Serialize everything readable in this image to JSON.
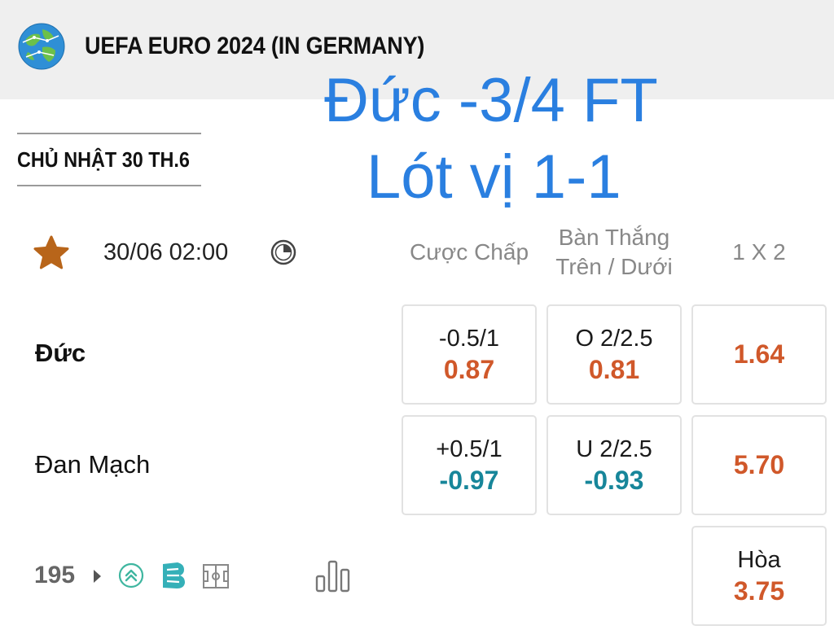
{
  "header": {
    "league_title": "UEFA EURO 2024 (IN GERMANY)",
    "league_icon": "globe-icon",
    "background": "#efefef"
  },
  "overlay": {
    "line1": "Đức -3/4 FT",
    "line2": "Lót vị 1-1",
    "color": "#2a7fe0"
  },
  "date_header": "CHỦ NHẬT 30 TH.6",
  "match": {
    "favorite_icon": "star-icon",
    "time": "30/06 02:00",
    "live_icon": "live-clock-icon",
    "home_team": "Đức",
    "away_team": "Đan Mạch",
    "more_markets_count": "195"
  },
  "columns": {
    "handicap": "Cược Chấp",
    "over_under_line1": "Bàn Thắng",
    "over_under_line2": "Trên / Dưới",
    "one_x_two": "1 X 2"
  },
  "odds": {
    "home": {
      "handicap_line": "-0.5/1",
      "handicap_price": "0.87",
      "ou_line": "O 2/2.5",
      "ou_price": "0.81",
      "win_price": "1.64"
    },
    "away": {
      "handicap_line": "+0.5/1",
      "handicap_price": "-0.97",
      "ou_line": "U 2/2.5",
      "ou_price": "-0.93",
      "win_price": "5.70"
    },
    "draw": {
      "label": "Hòa",
      "price": "3.75"
    }
  },
  "colors": {
    "positive_price": "#d0582a",
    "negative_price": "#17869a",
    "favorite_star": "#b8651a"
  },
  "footer_icons": [
    "double-chevron-up-icon",
    "b-badge-icon",
    "pitch-icon",
    "stats-bar-icon"
  ]
}
